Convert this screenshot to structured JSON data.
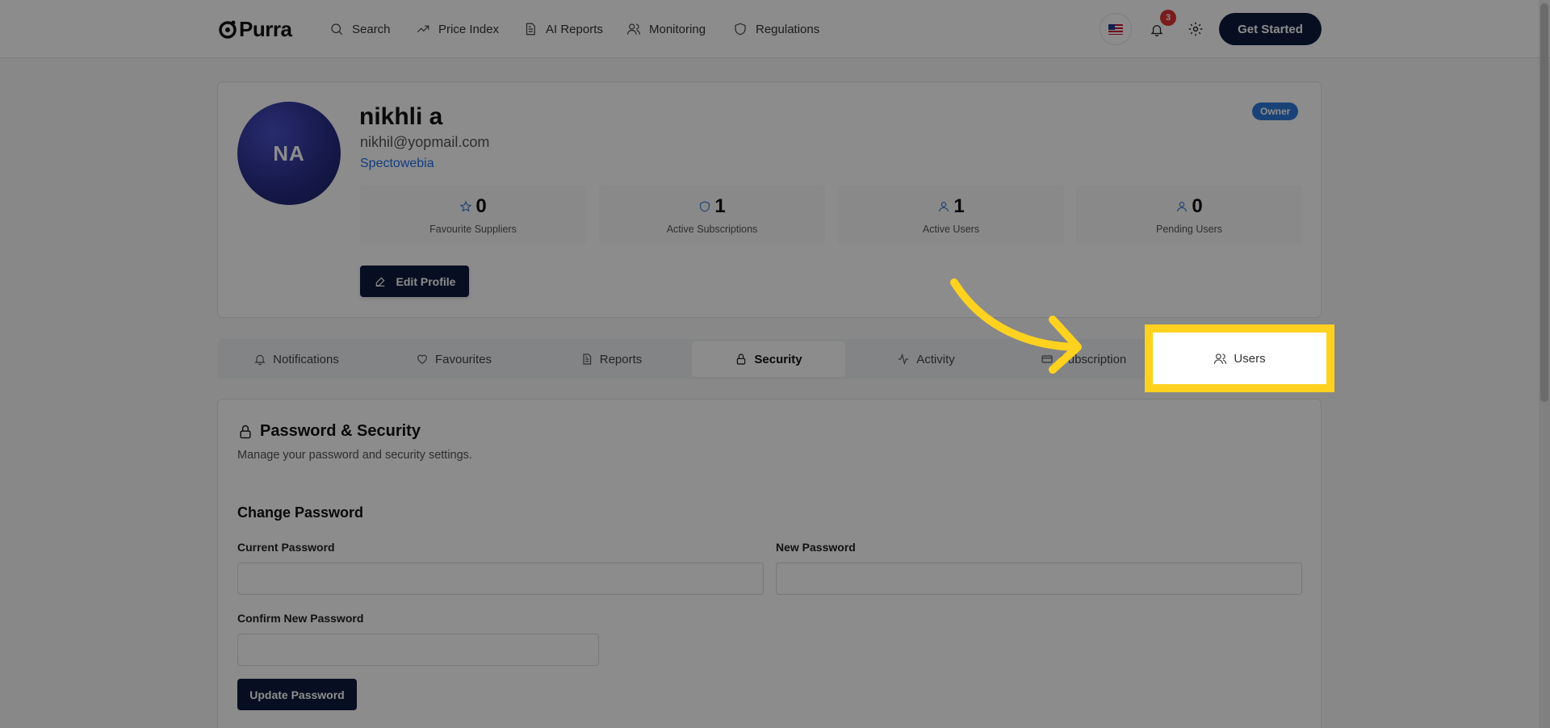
{
  "nav": {
    "brand": "Purra",
    "items": [
      {
        "label": "Search",
        "icon": "search-icon"
      },
      {
        "label": "Price Index",
        "icon": "trend-up-icon"
      },
      {
        "label": "AI Reports",
        "icon": "document-icon"
      },
      {
        "label": "Monitoring",
        "icon": "users-icon"
      },
      {
        "label": "Regulations",
        "icon": "shield-icon"
      }
    ],
    "notifications_count": "3",
    "get_started": "Get Started"
  },
  "profile": {
    "initials": "NA",
    "name": "nikhli a",
    "email": "nikhil@yopmail.com",
    "company": "Spectowebia",
    "role_badge": "Owner",
    "stats": [
      {
        "value": "0",
        "label": "Favourite Suppliers",
        "icon": "star-icon"
      },
      {
        "value": "1",
        "label": "Active Subscriptions",
        "icon": "shield-icon"
      },
      {
        "value": "1",
        "label": "Active Users",
        "icon": "user-icon"
      },
      {
        "value": "0",
        "label": "Pending Users",
        "icon": "user-icon"
      }
    ],
    "edit_button": "Edit Profile"
  },
  "tabs": [
    {
      "label": "Notifications",
      "icon": "bell-icon"
    },
    {
      "label": "Favourites",
      "icon": "heart-icon"
    },
    {
      "label": "Reports",
      "icon": "document-icon"
    },
    {
      "label": "Security",
      "icon": "lock-icon",
      "active": true
    },
    {
      "label": "Activity",
      "icon": "activity-icon"
    },
    {
      "label": "Subscription",
      "icon": "credit-card-icon"
    },
    {
      "label": "Users",
      "icon": "users-icon"
    }
  ],
  "security": {
    "title": "Password & Security",
    "description": "Manage your password and security settings.",
    "change_password_title": "Change Password",
    "current_password_label": "Current Password",
    "new_password_label": "New Password",
    "confirm_password_label": "Confirm New Password",
    "current_password_value": "",
    "new_password_value": "",
    "confirm_password_value": "",
    "update_button": "Update Password"
  },
  "colors": {
    "primary": "#0d1a3d",
    "accent": "#2f7bdb",
    "highlight": "#ffd21f",
    "badge": "#e03434"
  }
}
